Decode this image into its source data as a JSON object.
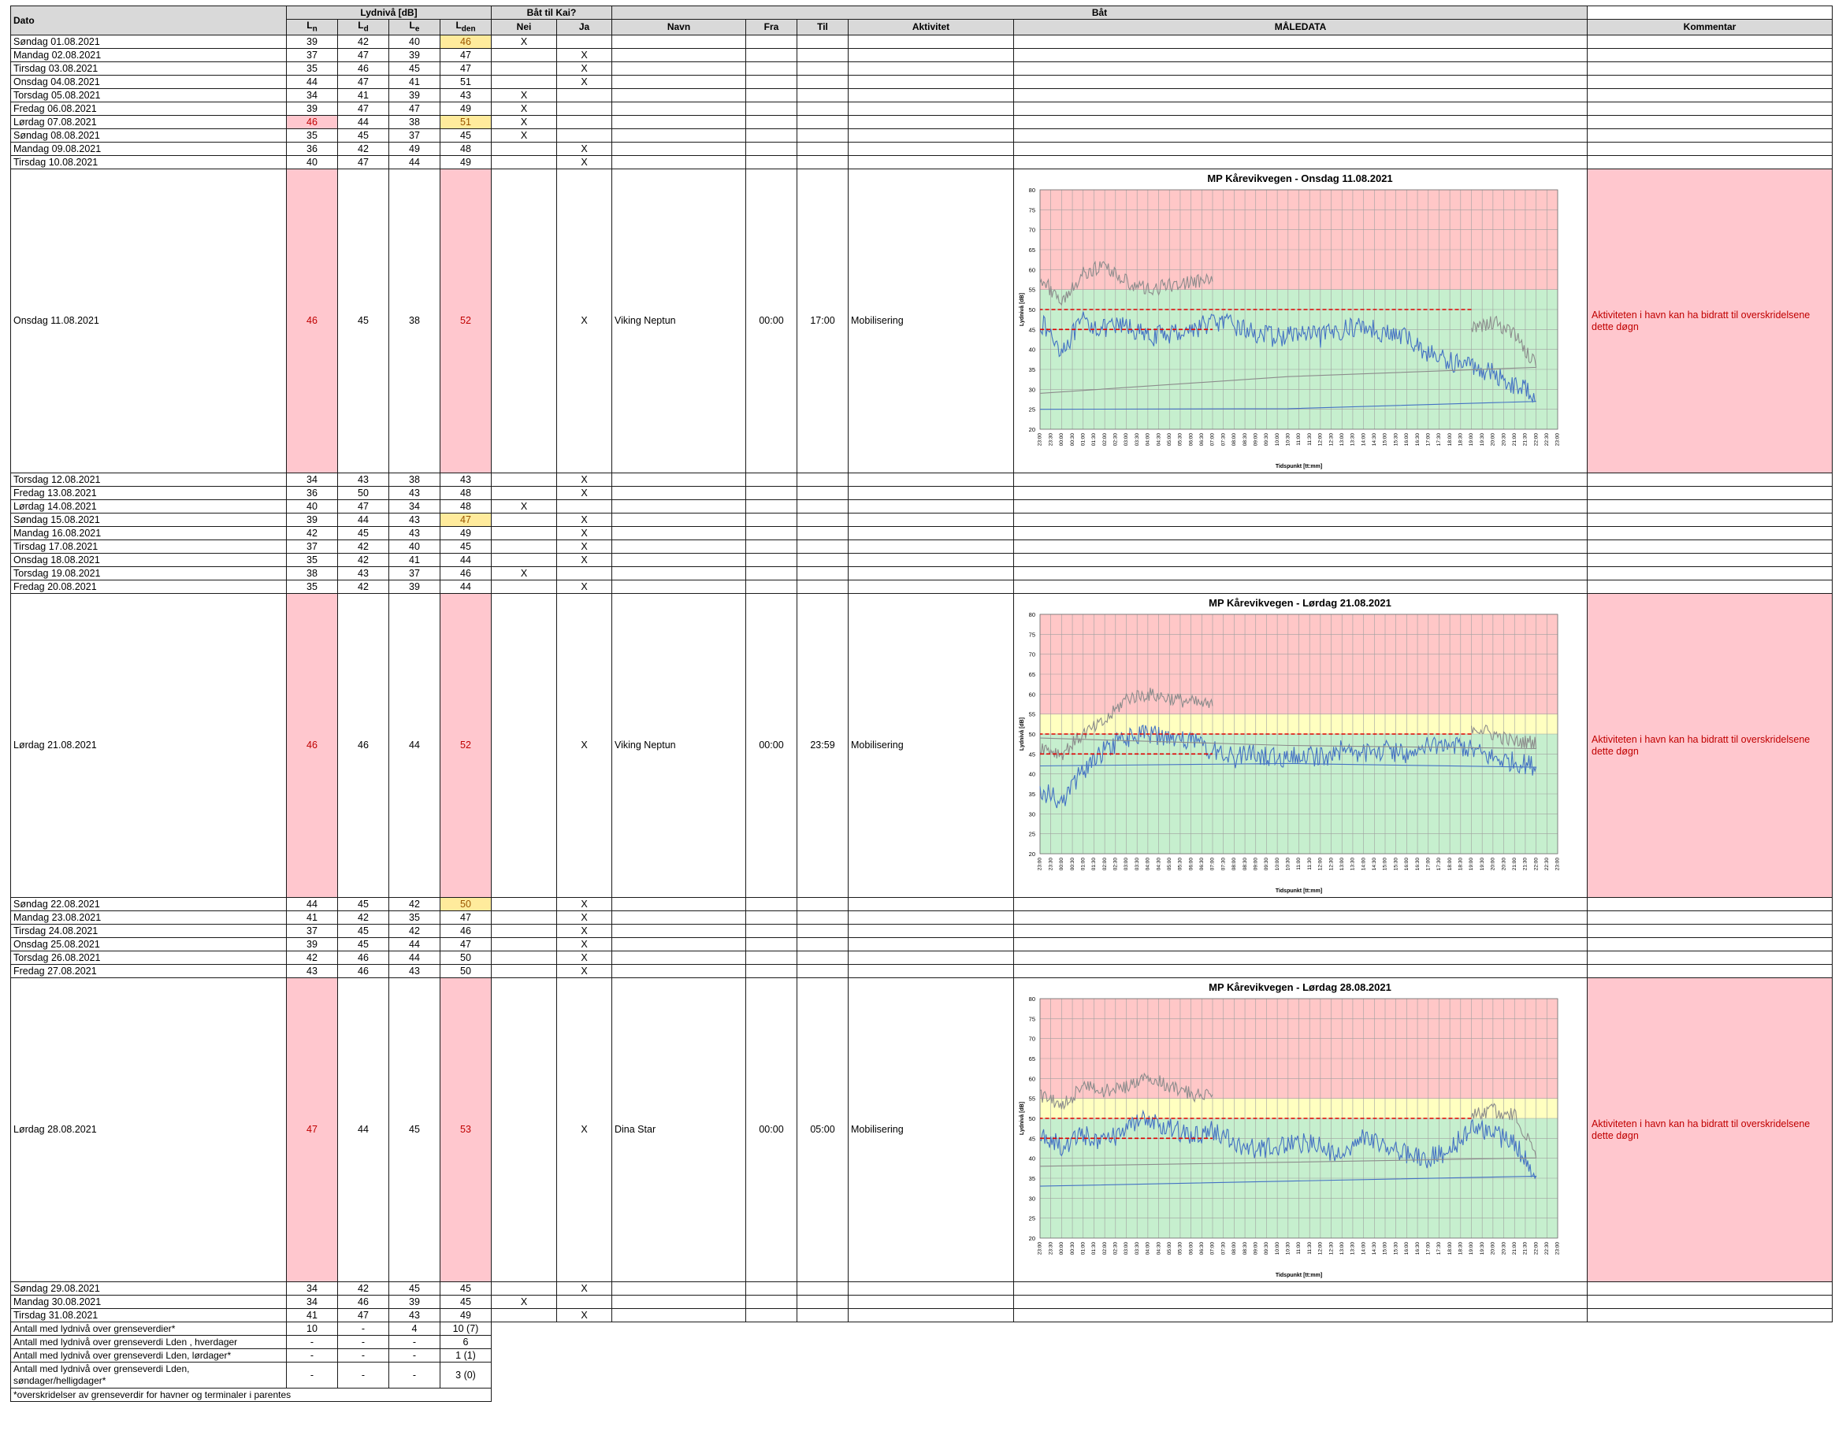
{
  "headers": {
    "dato": "Dato",
    "lydniva": "Lydnivå [dB]",
    "baat_til_kai": "Båt til Kai?",
    "baat": "Båt",
    "ln": "L",
    "ln_sub": "n",
    "ld": "L",
    "ld_sub": "d",
    "le": "L",
    "le_sub": "e",
    "lden": "L",
    "lden_sub": "den",
    "nei": "Nei",
    "ja": "Ja",
    "navn": "Navn",
    "fra": "Fra",
    "til": "Til",
    "aktivitet": "Aktivitet",
    "maledata": "MÅLEDATA",
    "kommentar": "Kommentar"
  },
  "rows": [
    {
      "dato": "Søndag 01.08.2021",
      "ln": "39",
      "ld": "42",
      "le": "40",
      "lden": "46",
      "nei": "X",
      "ja": "",
      "ln_hl": "",
      "lden_hl": "yel"
    },
    {
      "dato": "Mandag 02.08.2021",
      "ln": "37",
      "ld": "47",
      "le": "39",
      "lden": "47",
      "nei": "",
      "ja": "X",
      "ln_hl": "",
      "lden_hl": ""
    },
    {
      "dato": "Tirsdag 03.08.2021",
      "ln": "35",
      "ld": "46",
      "le": "45",
      "lden": "47",
      "nei": "",
      "ja": "X",
      "ln_hl": "",
      "lden_hl": ""
    },
    {
      "dato": "Onsdag 04.08.2021",
      "ln": "44",
      "ld": "47",
      "le": "41",
      "lden": "51",
      "nei": "",
      "ja": "X",
      "ln_hl": "",
      "lden_hl": ""
    },
    {
      "dato": "Torsdag 05.08.2021",
      "ln": "34",
      "ld": "41",
      "le": "39",
      "lden": "43",
      "nei": "X",
      "ja": "",
      "ln_hl": "",
      "lden_hl": ""
    },
    {
      "dato": "Fredag 06.08.2021",
      "ln": "39",
      "ld": "47",
      "le": "47",
      "lden": "49",
      "nei": "X",
      "ja": "",
      "ln_hl": "",
      "lden_hl": ""
    },
    {
      "dato": "Lørdag 07.08.2021",
      "ln": "46",
      "ld": "44",
      "le": "38",
      "lden": "51",
      "nei": "X",
      "ja": "",
      "ln_hl": "pink",
      "lden_hl": "yel"
    },
    {
      "dato": "Søndag 08.08.2021",
      "ln": "35",
      "ld": "45",
      "le": "37",
      "lden": "45",
      "nei": "X",
      "ja": "",
      "ln_hl": "",
      "lden_hl": ""
    },
    {
      "dato": "Mandag 09.08.2021",
      "ln": "36",
      "ld": "42",
      "le": "49",
      "lden": "48",
      "nei": "",
      "ja": "X",
      "ln_hl": "",
      "lden_hl": ""
    },
    {
      "dato": "Tirsdag 10.08.2021",
      "ln": "40",
      "ld": "47",
      "le": "44",
      "lden": "49",
      "nei": "",
      "ja": "X",
      "ln_hl": "",
      "lden_hl": ""
    },
    {
      "dato": "Onsdag 11.08.2021",
      "ln": "46",
      "ld": "45",
      "le": "38",
      "lden": "52",
      "nei": "",
      "ja": "X",
      "ln_hl": "pink",
      "lden_hl": "pink",
      "big": true,
      "navn": "Viking Neptun",
      "fra": "00:00",
      "til": "17:00",
      "aktivitet": "Mobilisering",
      "chart": 0,
      "kommentar": "Aktiviteten i havn kan ha bidratt til overskridelsene dette døgn"
    },
    {
      "dato": "Torsdag 12.08.2021",
      "ln": "34",
      "ld": "43",
      "le": "38",
      "lden": "43",
      "nei": "",
      "ja": "X",
      "ln_hl": "",
      "lden_hl": ""
    },
    {
      "dato": "Fredag 13.08.2021",
      "ln": "36",
      "ld": "50",
      "le": "43",
      "lden": "48",
      "nei": "",
      "ja": "X",
      "ln_hl": "",
      "lden_hl": ""
    },
    {
      "dato": "Lørdag 14.08.2021",
      "ln": "40",
      "ld": "47",
      "le": "34",
      "lden": "48",
      "nei": "X",
      "ja": "",
      "ln_hl": "",
      "lden_hl": ""
    },
    {
      "dato": "Søndag 15.08.2021",
      "ln": "39",
      "ld": "44",
      "le": "43",
      "lden": "47",
      "nei": "",
      "ja": "X",
      "ln_hl": "",
      "lden_hl": "yel"
    },
    {
      "dato": "Mandag 16.08.2021",
      "ln": "42",
      "ld": "45",
      "le": "43",
      "lden": "49",
      "nei": "",
      "ja": "X",
      "ln_hl": "",
      "lden_hl": ""
    },
    {
      "dato": "Tirsdag 17.08.2021",
      "ln": "37",
      "ld": "42",
      "le": "40",
      "lden": "45",
      "nei": "",
      "ja": "X",
      "ln_hl": "",
      "lden_hl": ""
    },
    {
      "dato": "Onsdag 18.08.2021",
      "ln": "35",
      "ld": "42",
      "le": "41",
      "lden": "44",
      "nei": "",
      "ja": "X",
      "ln_hl": "",
      "lden_hl": ""
    },
    {
      "dato": "Torsdag 19.08.2021",
      "ln": "38",
      "ld": "43",
      "le": "37",
      "lden": "46",
      "nei": "X",
      "ja": "",
      "ln_hl": "",
      "lden_hl": ""
    },
    {
      "dato": "Fredag 20.08.2021",
      "ln": "35",
      "ld": "42",
      "le": "39",
      "lden": "44",
      "nei": "",
      "ja": "X",
      "ln_hl": "",
      "lden_hl": ""
    },
    {
      "dato": "Lørdag 21.08.2021",
      "ln": "46",
      "ld": "46",
      "le": "44",
      "lden": "52",
      "nei": "",
      "ja": "X",
      "ln_hl": "pink",
      "lden_hl": "pink",
      "big": true,
      "navn": "Viking Neptun",
      "fra": "00:00",
      "til": "23:59",
      "aktivitet": "Mobilisering",
      "chart": 1,
      "kommentar": "Aktiviteten i havn kan ha bidratt til overskridelsene dette døgn"
    },
    {
      "dato": "Søndag 22.08.2021",
      "ln": "44",
      "ld": "45",
      "le": "42",
      "lden": "50",
      "nei": "",
      "ja": "X",
      "ln_hl": "",
      "lden_hl": "yel"
    },
    {
      "dato": "Mandag 23.08.2021",
      "ln": "41",
      "ld": "42",
      "le": "35",
      "lden": "47",
      "nei": "",
      "ja": "X",
      "ln_hl": "",
      "lden_hl": ""
    },
    {
      "dato": "Tirsdag 24.08.2021",
      "ln": "37",
      "ld": "45",
      "le": "42",
      "lden": "46",
      "nei": "",
      "ja": "X",
      "ln_hl": "",
      "lden_hl": ""
    },
    {
      "dato": "Onsdag 25.08.2021",
      "ln": "39",
      "ld": "45",
      "le": "44",
      "lden": "47",
      "nei": "",
      "ja": "X",
      "ln_hl": "",
      "lden_hl": ""
    },
    {
      "dato": "Torsdag 26.08.2021",
      "ln": "42",
      "ld": "46",
      "le": "44",
      "lden": "50",
      "nei": "",
      "ja": "X",
      "ln_hl": "",
      "lden_hl": ""
    },
    {
      "dato": "Fredag 27.08.2021",
      "ln": "43",
      "ld": "46",
      "le": "43",
      "lden": "50",
      "nei": "",
      "ja": "X",
      "ln_hl": "",
      "lden_hl": ""
    },
    {
      "dato": "Lørdag 28.08.2021",
      "ln": "47",
      "ld": "44",
      "le": "45",
      "lden": "53",
      "nei": "",
      "ja": "X",
      "ln_hl": "pink",
      "lden_hl": "pink",
      "big": true,
      "navn": "Dina Star",
      "fra": "00:00",
      "til": "05:00",
      "aktivitet": "Mobilisering",
      "chart": 2,
      "kommentar": "Aktiviteten i havn kan ha bidratt til overskridelsene dette døgn"
    },
    {
      "dato": "Søndag 29.08.2021",
      "ln": "34",
      "ld": "42",
      "le": "45",
      "lden": "45",
      "nei": "",
      "ja": "X",
      "ln_hl": "",
      "lden_hl": ""
    },
    {
      "dato": "Mandag 30.08.2021",
      "ln": "34",
      "ld": "46",
      "le": "39",
      "lden": "45",
      "nei": "X",
      "ja": "",
      "ln_hl": "",
      "lden_hl": ""
    },
    {
      "dato": "Tirsdag 31.08.2021",
      "ln": "41",
      "ld": "47",
      "le": "43",
      "lden": "49",
      "nei": "",
      "ja": "X",
      "ln_hl": "",
      "lden_hl": ""
    }
  ],
  "summary": [
    {
      "label": "Antall med lydnivå over grenseverdier*",
      "ln": "10",
      "ld": "-",
      "le": "4",
      "lden": "10 (7)"
    },
    {
      "label": "Antall med lydnivå over grenseverdi Lden , hverdager",
      "ln": "-",
      "ld": "-",
      "le": "-",
      "lden": "6"
    },
    {
      "label": "Antall med lydnivå over grenseverdi Lden, lørdager*",
      "ln": "-",
      "ld": "-",
      "le": "-",
      "lden": "1 (1)"
    },
    {
      "label": "Antall med lydnivå over grenseverdi Lden, søndager/helligdager*",
      "ln": "-",
      "ld": "-",
      "le": "-",
      "lden": "3 (0)"
    }
  ],
  "footnote": "*overskridelser av grenseverdir for havner og terminaler i parentes",
  "charts": {
    "ylabel": "Lydnivå [dB]",
    "xlabel": "Tidspunkt [tt:mm]",
    "yticks": [
      "20",
      "25",
      "30",
      "35",
      "40",
      "45",
      "50",
      "55",
      "60",
      "65",
      "70",
      "75",
      "80"
    ],
    "xticks": [
      "23:00",
      "23:30",
      "00:00",
      "00:30",
      "01:00",
      "01:30",
      "02:00",
      "02:30",
      "03:00",
      "03:30",
      "04:00",
      "04:30",
      "05:00",
      "05:30",
      "06:00",
      "06:30",
      "07:00",
      "07:30",
      "08:00",
      "08:30",
      "09:00",
      "09:30",
      "10:00",
      "10:30",
      "11:00",
      "11:30",
      "12:00",
      "12:30",
      "13:00",
      "13:30",
      "14:00",
      "14:30",
      "15:00",
      "15:30",
      "16:00",
      "16:30",
      "17:00",
      "17:30",
      "18:00",
      "18:30",
      "19:00",
      "19:30",
      "20:00",
      "20:30",
      "21:00",
      "21:30",
      "22:00",
      "22:30",
      "23:00"
    ],
    "colors": {
      "red": "#ffc7c7",
      "yellow": "#ffffc0",
      "green": "#c6efce",
      "series_blue": "#4472c4",
      "series_gray": "#8c8c8c",
      "limit_red": "#e00000",
      "grid": "#a0a0a0"
    }
  },
  "chart_data": [
    {
      "type": "line",
      "title": "MP Kårevikvegen - Onsdag 11.08.2021",
      "xlabel": "Tidspunkt [tt:mm]",
      "ylabel": "Lydnivå [dB]",
      "ylim": [
        20,
        80
      ],
      "zones": [
        {
          "from": 20,
          "to": 55,
          "color": "green"
        },
        {
          "from": 55,
          "to": 80,
          "color": "red"
        }
      ],
      "limits": [
        {
          "from": "23:00",
          "to": "07:00",
          "value": 45
        },
        {
          "from": "19:00",
          "to": "23:00",
          "value": 50
        }
      ],
      "series": [
        {
          "color": "blue",
          "x": [
            "23:00",
            "00:00",
            "01:00",
            "02:00",
            "03:00",
            "04:00",
            "05:00",
            "06:00",
            "07:00",
            "08:00",
            "09:00",
            "10:00",
            "11:00",
            "12:00",
            "13:00",
            "14:00",
            "15:00",
            "16:00",
            "17:00",
            "18:00",
            "19:00",
            "20:00",
            "21:00",
            "22:00",
            "23:00"
          ],
          "y": [
            47,
            40,
            47,
            45,
            46,
            43,
            44,
            45,
            47,
            46,
            44,
            43,
            44,
            43,
            45,
            46,
            44,
            43,
            39,
            37,
            36,
            34,
            31,
            29,
            25
          ]
        },
        {
          "color": "gray",
          "x": [
            "23:00",
            "00:00",
            "01:00",
            "02:00",
            "03:00",
            "04:00",
            "05:00",
            "06:00",
            "07:00",
            "19:00",
            "20:00",
            "21:00",
            "22:00",
            "23:00"
          ],
          "y": [
            58,
            52,
            59,
            61,
            57,
            55,
            56,
            57,
            57,
            45,
            47,
            44,
            36,
            29
          ]
        }
      ]
    },
    {
      "type": "line",
      "title": "MP Kårevikvegen - Lørdag 21.08.2021",
      "xlabel": "Tidspunkt [tt:mm]",
      "ylabel": "Lydnivå [dB]",
      "ylim": [
        20,
        80
      ],
      "zones": [
        {
          "from": 20,
          "to": 50,
          "color": "green"
        },
        {
          "from": 50,
          "to": 55,
          "color": "yellow"
        },
        {
          "from": 55,
          "to": 80,
          "color": "red"
        }
      ],
      "limits": [
        {
          "from": "23:00",
          "to": "07:00",
          "value": 45
        },
        {
          "from": "19:00",
          "to": "23:00",
          "value": 50
        }
      ],
      "series": [
        {
          "color": "blue",
          "x": [
            "23:00",
            "00:00",
            "01:00",
            "02:00",
            "03:00",
            "04:00",
            "05:00",
            "06:00",
            "07:00",
            "08:00",
            "09:00",
            "10:00",
            "11:00",
            "12:00",
            "13:00",
            "14:00",
            "15:00",
            "16:00",
            "17:00",
            "18:00",
            "19:00",
            "20:00",
            "21:00",
            "22:00",
            "23:00"
          ],
          "y": [
            36,
            33,
            41,
            46,
            49,
            50,
            49,
            48,
            46,
            44,
            45,
            44,
            45,
            44,
            46,
            45,
            46,
            45,
            47,
            48,
            46,
            44,
            43,
            42,
            42
          ]
        },
        {
          "color": "gray",
          "x": [
            "23:00",
            "00:00",
            "01:00",
            "02:00",
            "03:00",
            "04:00",
            "05:00",
            "06:00",
            "07:00",
            "19:00",
            "20:00",
            "21:00",
            "22:00",
            "23:00"
          ],
          "y": [
            47,
            45,
            50,
            53,
            59,
            60,
            59,
            58,
            57,
            52,
            50,
            48,
            48,
            49
          ]
        }
      ]
    },
    {
      "type": "line",
      "title": "MP Kårevikvegen - Lørdag 28.08.2021",
      "xlabel": "Tidspunkt [tt:mm]",
      "ylabel": "Lydnivå [dB]",
      "ylim": [
        20,
        80
      ],
      "zones": [
        {
          "from": 20,
          "to": 50,
          "color": "green"
        },
        {
          "from": 50,
          "to": 55,
          "color": "yellow"
        },
        {
          "from": 55,
          "to": 80,
          "color": "red"
        }
      ],
      "limits": [
        {
          "from": "23:00",
          "to": "07:00",
          "value": 45
        },
        {
          "from": "19:00",
          "to": "23:00",
          "value": 50
        }
      ],
      "series": [
        {
          "color": "blue",
          "x": [
            "23:00",
            "00:00",
            "01:00",
            "02:00",
            "03:00",
            "04:00",
            "05:00",
            "06:00",
            "07:00",
            "08:00",
            "09:00",
            "10:00",
            "11:00",
            "12:00",
            "13:00",
            "14:00",
            "15:00",
            "16:00",
            "17:00",
            "18:00",
            "19:00",
            "20:00",
            "21:00",
            "22:00",
            "23:00"
          ],
          "y": [
            46,
            43,
            46,
            44,
            47,
            50,
            48,
            45,
            47,
            44,
            42,
            43,
            44,
            43,
            40,
            45,
            43,
            41,
            40,
            42,
            48,
            46,
            44,
            35,
            33
          ]
        },
        {
          "color": "gray",
          "x": [
            "23:00",
            "00:00",
            "01:00",
            "02:00",
            "03:00",
            "04:00",
            "05:00",
            "06:00",
            "07:00",
            "19:00",
            "20:00",
            "21:00",
            "22:00",
            "23:00"
          ],
          "y": [
            56,
            53,
            58,
            57,
            58,
            61,
            58,
            56,
            56,
            51,
            52,
            51,
            41,
            38
          ]
        }
      ]
    }
  ]
}
